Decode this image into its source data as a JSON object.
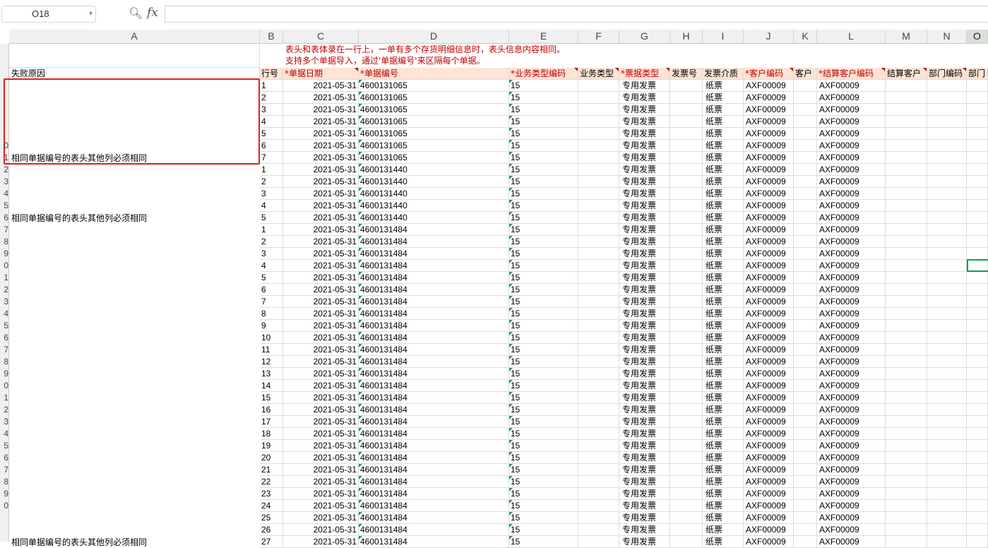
{
  "name_box": "O18",
  "formula_value": "",
  "columns": [
    "A",
    "B",
    "C",
    "D",
    "E",
    "F",
    "G",
    "H",
    "I",
    "J",
    "K",
    "L",
    "M",
    "N",
    "O"
  ],
  "active_column": "O",
  "notes": [
    "表头和表体录在一行上，一单有多个存货明细信息时，表头信息内容相同。",
    "支持多个单据导入，通过'单据编号'来区隔每个单据。"
  ],
  "header_row": {
    "A": "失败原因",
    "B": "行号",
    "C": "*单据日期",
    "D": "*单据编号",
    "E": "*业务类型编码",
    "F": "业务类型",
    "G": "*票据类型",
    "H": "发票号",
    "I": "发票介质",
    "J": "*客户编码",
    "K": "客户",
    "L": "*结算客户编码",
    "M": "结算客户",
    "N": "部门编码",
    "O": "部门"
  },
  "fail_reason": "相同单据编号的表头其他列必须相同",
  "row_numbers": [
    "",
    "",
    "",
    "",
    "",
    "",
    "",
    "",
    "0",
    "1",
    "2",
    "3",
    "4",
    "5",
    "6",
    "7",
    "8",
    "9",
    "0",
    "1",
    "2",
    "3",
    "4",
    "5",
    "6",
    "7",
    "8",
    "9",
    "0",
    "1",
    "2",
    "3",
    "4",
    "5",
    "6",
    "7",
    "8",
    "9",
    "0"
  ],
  "rows": [
    {
      "line": "1",
      "date": "2021-05-31",
      "doc": "4600131065",
      "biz": "15",
      "ticket": "专用发票",
      "medium": "纸票",
      "cust": "AXF00009",
      "settle": "AXF00009"
    },
    {
      "line": "2",
      "date": "2021-05-31",
      "doc": "4600131065",
      "biz": "15",
      "ticket": "专用发票",
      "medium": "纸票",
      "cust": "AXF00009",
      "settle": "AXF00009"
    },
    {
      "line": "3",
      "date": "2021-05-31",
      "doc": "4600131065",
      "biz": "15",
      "ticket": "专用发票",
      "medium": "纸票",
      "cust": "AXF00009",
      "settle": "AXF00009"
    },
    {
      "line": "4",
      "date": "2021-05-31",
      "doc": "4600131065",
      "biz": "15",
      "ticket": "专用发票",
      "medium": "纸票",
      "cust": "AXF00009",
      "settle": "AXF00009"
    },
    {
      "line": "5",
      "date": "2021-05-31",
      "doc": "4600131065",
      "biz": "15",
      "ticket": "专用发票",
      "medium": "纸票",
      "cust": "AXF00009",
      "settle": "AXF00009"
    },
    {
      "line": "6",
      "date": "2021-05-31",
      "doc": "4600131065",
      "biz": "15",
      "ticket": "专用发票",
      "medium": "纸票",
      "cust": "AXF00009",
      "settle": "AXF00009"
    },
    {
      "line": "7",
      "date": "2021-05-31",
      "doc": "4600131065",
      "biz": "15",
      "ticket": "专用发票",
      "medium": "纸票",
      "cust": "AXF00009",
      "settle": "AXF00009",
      "fail": true
    },
    {
      "line": "1",
      "date": "2021-05-31",
      "doc": "4600131440",
      "biz": "15",
      "ticket": "专用发票",
      "medium": "纸票",
      "cust": "AXF00009",
      "settle": "AXF00009"
    },
    {
      "line": "2",
      "date": "2021-05-31",
      "doc": "4600131440",
      "biz": "15",
      "ticket": "专用发票",
      "medium": "纸票",
      "cust": "AXF00009",
      "settle": "AXF00009"
    },
    {
      "line": "3",
      "date": "2021-05-31",
      "doc": "4600131440",
      "biz": "15",
      "ticket": "专用发票",
      "medium": "纸票",
      "cust": "AXF00009",
      "settle": "AXF00009"
    },
    {
      "line": "4",
      "date": "2021-05-31",
      "doc": "4600131440",
      "biz": "15",
      "ticket": "专用发票",
      "medium": "纸票",
      "cust": "AXF00009",
      "settle": "AXF00009"
    },
    {
      "line": "5",
      "date": "2021-05-31",
      "doc": "4600131440",
      "biz": "15",
      "ticket": "专用发票",
      "medium": "纸票",
      "cust": "AXF00009",
      "settle": "AXF00009",
      "fail": true
    },
    {
      "line": "1",
      "date": "2021-05-31",
      "doc": "4600131484",
      "biz": "15",
      "ticket": "专用发票",
      "medium": "纸票",
      "cust": "AXF00009",
      "settle": "AXF00009"
    },
    {
      "line": "2",
      "date": "2021-05-31",
      "doc": "4600131484",
      "biz": "15",
      "ticket": "专用发票",
      "medium": "纸票",
      "cust": "AXF00009",
      "settle": "AXF00009"
    },
    {
      "line": "3",
      "date": "2021-05-31",
      "doc": "4600131484",
      "biz": "15",
      "ticket": "专用发票",
      "medium": "纸票",
      "cust": "AXF00009",
      "settle": "AXF00009"
    },
    {
      "line": "4",
      "date": "2021-05-31",
      "doc": "4600131484",
      "biz": "15",
      "ticket": "专用发票",
      "medium": "纸票",
      "cust": "AXF00009",
      "settle": "AXF00009"
    },
    {
      "line": "5",
      "date": "2021-05-31",
      "doc": "4600131484",
      "biz": "15",
      "ticket": "专用发票",
      "medium": "纸票",
      "cust": "AXF00009",
      "settle": "AXF00009"
    },
    {
      "line": "6",
      "date": "2021-05-31",
      "doc": "4600131484",
      "biz": "15",
      "ticket": "专用发票",
      "medium": "纸票",
      "cust": "AXF00009",
      "settle": "AXF00009"
    },
    {
      "line": "7",
      "date": "2021-05-31",
      "doc": "4600131484",
      "biz": "15",
      "ticket": "专用发票",
      "medium": "纸票",
      "cust": "AXF00009",
      "settle": "AXF00009"
    },
    {
      "line": "8",
      "date": "2021-05-31",
      "doc": "4600131484",
      "biz": "15",
      "ticket": "专用发票",
      "medium": "纸票",
      "cust": "AXF00009",
      "settle": "AXF00009"
    },
    {
      "line": "9",
      "date": "2021-05-31",
      "doc": "4600131484",
      "biz": "15",
      "ticket": "专用发票",
      "medium": "纸票",
      "cust": "AXF00009",
      "settle": "AXF00009"
    },
    {
      "line": "10",
      "date": "2021-05-31",
      "doc": "4600131484",
      "biz": "15",
      "ticket": "专用发票",
      "medium": "纸票",
      "cust": "AXF00009",
      "settle": "AXF00009"
    },
    {
      "line": "11",
      "date": "2021-05-31",
      "doc": "4600131484",
      "biz": "15",
      "ticket": "专用发票",
      "medium": "纸票",
      "cust": "AXF00009",
      "settle": "AXF00009"
    },
    {
      "line": "12",
      "date": "2021-05-31",
      "doc": "4600131484",
      "biz": "15",
      "ticket": "专用发票",
      "medium": "纸票",
      "cust": "AXF00009",
      "settle": "AXF00009"
    },
    {
      "line": "13",
      "date": "2021-05-31",
      "doc": "4600131484",
      "biz": "15",
      "ticket": "专用发票",
      "medium": "纸票",
      "cust": "AXF00009",
      "settle": "AXF00009"
    },
    {
      "line": "14",
      "date": "2021-05-31",
      "doc": "4600131484",
      "biz": "15",
      "ticket": "专用发票",
      "medium": "纸票",
      "cust": "AXF00009",
      "settle": "AXF00009"
    },
    {
      "line": "15",
      "date": "2021-05-31",
      "doc": "4600131484",
      "biz": "15",
      "ticket": "专用发票",
      "medium": "纸票",
      "cust": "AXF00009",
      "settle": "AXF00009"
    },
    {
      "line": "16",
      "date": "2021-05-31",
      "doc": "4600131484",
      "biz": "15",
      "ticket": "专用发票",
      "medium": "纸票",
      "cust": "AXF00009",
      "settle": "AXF00009"
    },
    {
      "line": "17",
      "date": "2021-05-31",
      "doc": "4600131484",
      "biz": "15",
      "ticket": "专用发票",
      "medium": "纸票",
      "cust": "AXF00009",
      "settle": "AXF00009"
    },
    {
      "line": "18",
      "date": "2021-05-31",
      "doc": "4600131484",
      "biz": "15",
      "ticket": "专用发票",
      "medium": "纸票",
      "cust": "AXF00009",
      "settle": "AXF00009"
    },
    {
      "line": "19",
      "date": "2021-05-31",
      "doc": "4600131484",
      "biz": "15",
      "ticket": "专用发票",
      "medium": "纸票",
      "cust": "AXF00009",
      "settle": "AXF00009"
    },
    {
      "line": "20",
      "date": "2021-05-31",
      "doc": "4600131484",
      "biz": "15",
      "ticket": "专用发票",
      "medium": "纸票",
      "cust": "AXF00009",
      "settle": "AXF00009"
    },
    {
      "line": "21",
      "date": "2021-05-31",
      "doc": "4600131484",
      "biz": "15",
      "ticket": "专用发票",
      "medium": "纸票",
      "cust": "AXF00009",
      "settle": "AXF00009"
    },
    {
      "line": "22",
      "date": "2021-05-31",
      "doc": "4600131484",
      "biz": "15",
      "ticket": "专用发票",
      "medium": "纸票",
      "cust": "AXF00009",
      "settle": "AXF00009"
    },
    {
      "line": "23",
      "date": "2021-05-31",
      "doc": "4600131484",
      "biz": "15",
      "ticket": "专用发票",
      "medium": "纸票",
      "cust": "AXF00009",
      "settle": "AXF00009"
    },
    {
      "line": "24",
      "date": "2021-05-31",
      "doc": "4600131484",
      "biz": "15",
      "ticket": "专用发票",
      "medium": "纸票",
      "cust": "AXF00009",
      "settle": "AXF00009"
    },
    {
      "line": "25",
      "date": "2021-05-31",
      "doc": "4600131484",
      "biz": "15",
      "ticket": "专用发票",
      "medium": "纸票",
      "cust": "AXF00009",
      "settle": "AXF00009"
    },
    {
      "line": "26",
      "date": "2021-05-31",
      "doc": "4600131484",
      "biz": "15",
      "ticket": "专用发票",
      "medium": "纸票",
      "cust": "AXF00009",
      "settle": "AXF00009"
    },
    {
      "line": "27",
      "date": "2021-05-31",
      "doc": "4600131484",
      "biz": "15",
      "ticket": "专用发票",
      "medium": "纸票",
      "cust": "AXF00009",
      "settle": "AXF00009",
      "fail": true
    }
  ],
  "colors": {
    "highlight_box": "#e02020",
    "selection": "#1a9850",
    "required_text": "#c00000",
    "header_fill": "#fce4d6"
  }
}
